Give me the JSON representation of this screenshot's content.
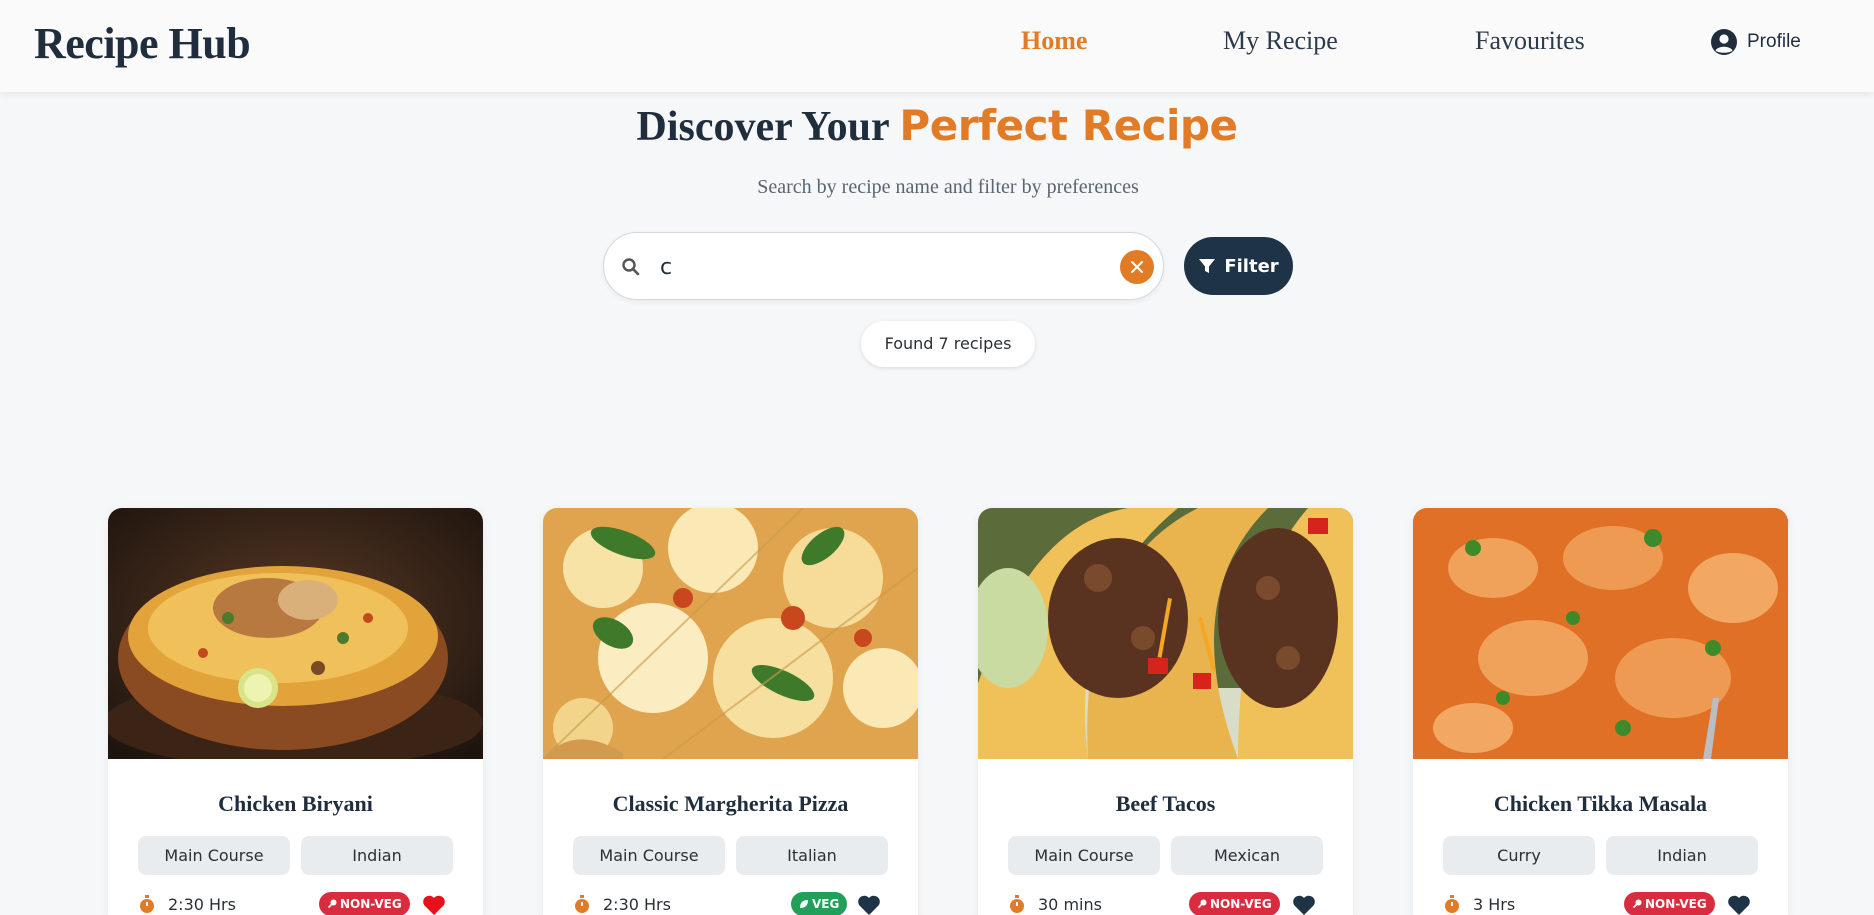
{
  "navbar": {
    "brand": "Recipe Hub",
    "links": [
      {
        "label": "Home",
        "active": true
      },
      {
        "label": "My Recipe",
        "active": false
      },
      {
        "label": "Favourites",
        "active": false
      }
    ],
    "profile_label": "Profile"
  },
  "hero": {
    "title_part1": "Discover Your ",
    "title_part2": "Perfect Recipe",
    "subtitle": "Search by recipe name and filter by preferences"
  },
  "search": {
    "value": "c",
    "placeholder": "",
    "filter_label": "Filter"
  },
  "results_text": "Found 7 recipes",
  "colors": {
    "accent": "#e27b26",
    "navy": "#1f3347",
    "nonveg": "#d92d3f",
    "veg": "#22a05a",
    "heart_active": "#e8101b",
    "heart_inactive": "#1f3347"
  },
  "recipes": [
    {
      "title": "Chicken Biryani",
      "tags": [
        "Main Course",
        "Indian"
      ],
      "time": "2:30 Hrs",
      "diet": "NON-VEG",
      "favourite": true,
      "image": "biryani"
    },
    {
      "title": "Classic Margherita Pizza",
      "tags": [
        "Main Course",
        "Italian"
      ],
      "time": "2:30 Hrs",
      "diet": "VEG",
      "favourite": false,
      "image": "pizza"
    },
    {
      "title": "Beef Tacos",
      "tags": [
        "Main Course",
        "Mexican"
      ],
      "time": "30 mins",
      "diet": "NON-VEG",
      "favourite": false,
      "image": "tacos"
    },
    {
      "title": "Chicken Tikka Masala",
      "tags": [
        "Curry",
        "Indian"
      ],
      "time": "3 Hrs",
      "diet": "NON-VEG",
      "favourite": false,
      "image": "tikka-masala"
    }
  ]
}
